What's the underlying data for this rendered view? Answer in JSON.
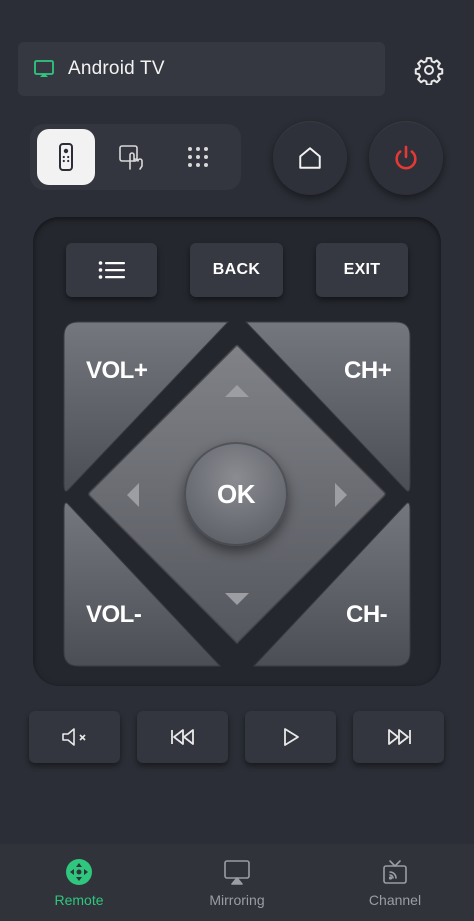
{
  "device": {
    "name": "Android TV",
    "icon": "cast-icon"
  },
  "header": {
    "settings_icon": "gear-icon"
  },
  "modes": [
    {
      "id": "remote",
      "icon": "remote-icon",
      "selected": true
    },
    {
      "id": "touch",
      "icon": "touch-icon",
      "selected": false
    },
    {
      "id": "numpad",
      "icon": "numpad-icon",
      "selected": false
    }
  ],
  "controls": {
    "home_icon": "home-icon",
    "power_icon": "power-icon",
    "menu_icon": "list-icon",
    "back_label": "BACK",
    "exit_label": "EXIT"
  },
  "dpad": {
    "vol_up": "VOL+",
    "ch_up": "CH+",
    "vol_down": "VOL-",
    "ch_down": "CH-",
    "ok": "OK"
  },
  "media": [
    {
      "id": "mute",
      "icon": "mute-icon"
    },
    {
      "id": "rewind",
      "icon": "rewind-icon"
    },
    {
      "id": "play",
      "icon": "play-icon"
    },
    {
      "id": "forward",
      "icon": "fast-forward-icon"
    }
  ],
  "nav": {
    "items": [
      {
        "label": "Remote",
        "icon": "dpad-icon",
        "active": true
      },
      {
        "label": "Mirroring",
        "icon": "mirroring-icon",
        "active": false
      },
      {
        "label": "Channel",
        "icon": "channel-icon",
        "active": false
      }
    ]
  },
  "colors": {
    "background": "#2b2e36",
    "accent": "#2fc77e",
    "power": "#e53935",
    "panel": "#24272e"
  }
}
